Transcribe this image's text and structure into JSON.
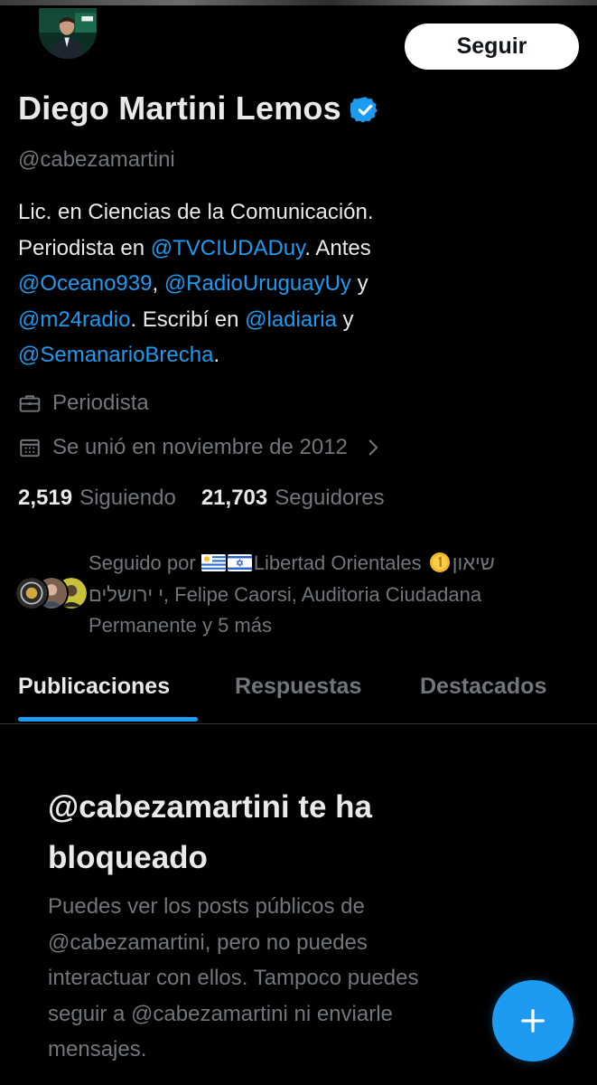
{
  "profile": {
    "display_name": "Diego Martini Lemos",
    "handle": "@cabezamartini",
    "follow_label": "Seguir",
    "verified": true,
    "bio": {
      "line1": "Lic. en Ciencias de la Comunicación.",
      "line2_pre": "Periodista en ",
      "line2_mention": "@TVCIUDADuy",
      "line2_post": ". Antes",
      "line3_mention1": "@Oceano939",
      "line3_sep": ", ",
      "line3_mention2": "@RadioUruguayUy",
      "line3_post": " y",
      "line4_mention1": "@m24radio",
      "line4_mid": ". Escribí en ",
      "line4_mention2": "@ladiaria",
      "line4_post": " y",
      "line5_mention": "@SemanarioBrecha",
      "line5_post": "."
    },
    "profession": "Periodista",
    "joined": "Se unió en noviembre de 2012"
  },
  "counts": {
    "following_count": "2,519",
    "following_label": "Siguiendo",
    "followers_count": "21,703",
    "followers_label": "Seguidores"
  },
  "followed_by": {
    "line1_pre": "Seguido por ",
    "line1_name": "Libertad Orientales ",
    "line1_post": "שיאון",
    "line2": "י ירושלים, Felipe Caorsi, Auditoria Ciudadana",
    "line3": "Permanente y 5 más"
  },
  "tabs": [
    {
      "label": "Publicaciones",
      "active": true
    },
    {
      "label": "Respuestas",
      "active": false
    },
    {
      "label": "Destacados",
      "active": false
    }
  ],
  "blocked": {
    "title_line1": "@cabezamartini te ha",
    "title_line2": "bloqueado",
    "body_line1": "Puedes ver los posts públicos de",
    "body_line2": "@cabezamartini, pero no puedes",
    "body_line3": "interactuar con ellos. Tampoco puedes",
    "body_line4": "seguir a @cabezamartini ni enviarle",
    "body_line5": "mensajes."
  },
  "icons": {
    "verified": "verified-badge-icon",
    "profession": "briefcase-icon",
    "joined": "calendar-icon",
    "expand": "chevron-right-icon",
    "compose": "plus-icon"
  },
  "colors": {
    "background": "#000000",
    "text_primary": "#e7e9ea",
    "text_secondary": "#71767b",
    "accent": "#1d9bf0",
    "button_bg": "#ffffff"
  }
}
